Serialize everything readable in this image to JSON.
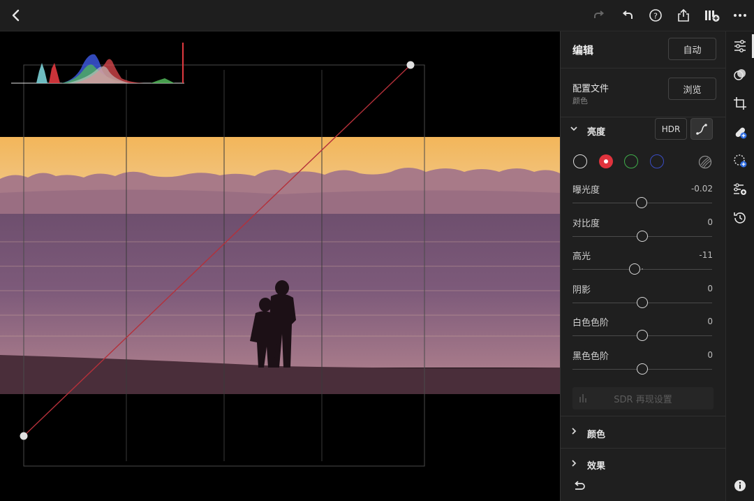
{
  "header": {
    "back_icon": "chevron-left-icon",
    "redo_icon": "redo-icon",
    "undo_icon": "undo-icon",
    "help_icon": "help-icon",
    "share_icon": "share-icon",
    "add_preset_icon": "add-preset-icon",
    "more_icon": "more-icon"
  },
  "panel": {
    "title": "编辑",
    "auto_label": "自动",
    "profile": {
      "label": "配置文件",
      "value": "颜色",
      "browse_label": "浏览"
    },
    "light": {
      "title": "亮度",
      "hdr_label": "HDR",
      "curve_icon": "curve-icon",
      "channels": [
        {
          "name": "white",
          "color": "#e0e0e0",
          "active": false
        },
        {
          "name": "red",
          "color": "#e0333d",
          "active": true
        },
        {
          "name": "green",
          "color": "#3fae4a",
          "active": false
        },
        {
          "name": "blue",
          "color": "#3a4cc4",
          "active": false
        }
      ],
      "sliders": [
        {
          "label": "曝光度",
          "value": "-0.02",
          "position": 0.495
        },
        {
          "label": "对比度",
          "value": "0",
          "position": 0.5
        },
        {
          "label": "高光",
          "value": "-11",
          "position": 0.445
        },
        {
          "label": "阴影",
          "value": "0",
          "position": 0.5
        },
        {
          "label": "白色色阶",
          "value": "0",
          "position": 0.5
        },
        {
          "label": "黑色色阶",
          "value": "0",
          "position": 0.5
        }
      ],
      "sdr_label": "SDR 再现设置"
    },
    "color_section": "颜色",
    "effects_section": "效果",
    "reset_icon": "reset-icon"
  },
  "rail": {
    "icons": [
      "edit-sliders-icon",
      "masking-icon",
      "crop-icon",
      "healing-icon",
      "selective-icon",
      "presets-icon",
      "history-icon"
    ],
    "info_icon": "info-icon"
  },
  "colors": {
    "accent_red": "#e0333d",
    "panel_bg": "#1f1f1f"
  }
}
